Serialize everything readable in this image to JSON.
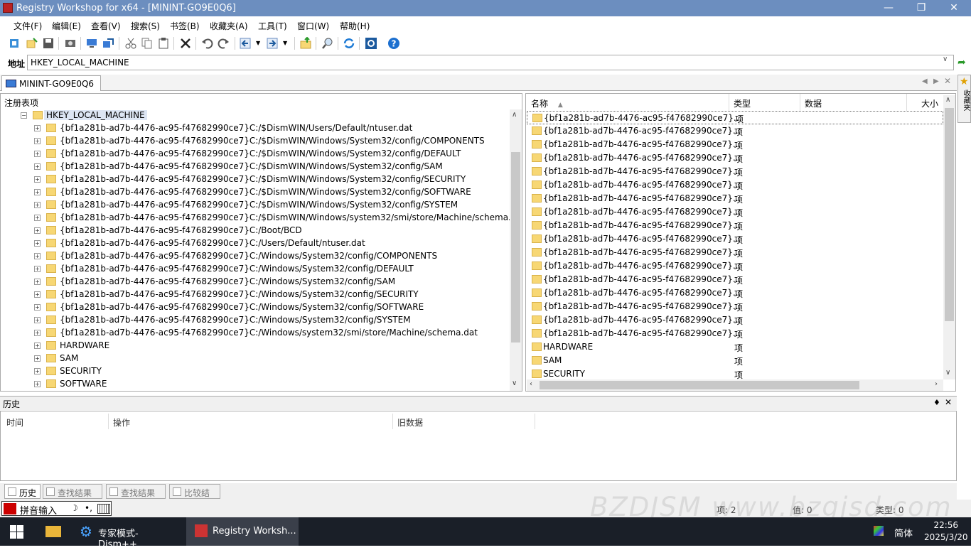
{
  "window": {
    "title": "Registry Workshop for x64 - [MININT-GO9E0Q6]"
  },
  "menu": [
    "文件(F)",
    "编辑(E)",
    "查看(V)",
    "搜索(S)",
    "书签(B)",
    "收藏夹(A)",
    "工具(T)",
    "窗口(W)",
    "帮助(H)"
  ],
  "toolbar": {
    "icons": [
      "connect-icon",
      "new-key-icon",
      "save-icon",
      "snapshot-icon",
      "computer-icon",
      "export-icon",
      "cut-icon",
      "copy-icon",
      "paste-icon",
      "delete-icon",
      "undo-icon",
      "redo-icon",
      "back-icon",
      "forward-icon",
      "parent-key-icon",
      "find-icon",
      "refresh-icon",
      "settings-icon",
      "help-icon"
    ]
  },
  "address": {
    "label": "地址",
    "value": "HKEY_LOCAL_MACHINE"
  },
  "doc_tab": {
    "label": "MININT-GO9E0Q6"
  },
  "sidebar": {
    "label": "收藏夹"
  },
  "tree": {
    "header": "注册表项",
    "root": "HKEY_LOCAL_MACHINE",
    "items": [
      "{bf1a281b-ad7b-4476-ac95-f47682990ce7}C:/$DismWIN/Users/Default/ntuser.dat",
      "{bf1a281b-ad7b-4476-ac95-f47682990ce7}C:/$DismWIN/Windows/System32/config/COMPONENTS",
      "{bf1a281b-ad7b-4476-ac95-f47682990ce7}C:/$DismWIN/Windows/System32/config/DEFAULT",
      "{bf1a281b-ad7b-4476-ac95-f47682990ce7}C:/$DismWIN/Windows/System32/config/SAM",
      "{bf1a281b-ad7b-4476-ac95-f47682990ce7}C:/$DismWIN/Windows/System32/config/SECURITY",
      "{bf1a281b-ad7b-4476-ac95-f47682990ce7}C:/$DismWIN/Windows/System32/config/SOFTWARE",
      "{bf1a281b-ad7b-4476-ac95-f47682990ce7}C:/$DismWIN/Windows/System32/config/SYSTEM",
      "{bf1a281b-ad7b-4476-ac95-f47682990ce7}C:/$DismWIN/Windows/system32/smi/store/Machine/schema.dat",
      "{bf1a281b-ad7b-4476-ac95-f47682990ce7}C:/Boot/BCD",
      "{bf1a281b-ad7b-4476-ac95-f47682990ce7}C:/Users/Default/ntuser.dat",
      "{bf1a281b-ad7b-4476-ac95-f47682990ce7}C:/Windows/System32/config/COMPONENTS",
      "{bf1a281b-ad7b-4476-ac95-f47682990ce7}C:/Windows/System32/config/DEFAULT",
      "{bf1a281b-ad7b-4476-ac95-f47682990ce7}C:/Windows/System32/config/SAM",
      "{bf1a281b-ad7b-4476-ac95-f47682990ce7}C:/Windows/System32/config/SECURITY",
      "{bf1a281b-ad7b-4476-ac95-f47682990ce7}C:/Windows/System32/config/SOFTWARE",
      "{bf1a281b-ad7b-4476-ac95-f47682990ce7}C:/Windows/System32/config/SYSTEM",
      "{bf1a281b-ad7b-4476-ac95-f47682990ce7}C:/Windows/system32/smi/store/Machine/schema.dat",
      "HARDWARE",
      "SAM",
      "SECURITY",
      "SOFTWARE"
    ]
  },
  "list": {
    "columns": [
      "名称",
      "类型",
      "数据",
      "大小"
    ],
    "rows": [
      {
        "name": "{bf1a281b-ad7b-4476-ac95-f47682990ce7}...",
        "type": "项"
      },
      {
        "name": "{bf1a281b-ad7b-4476-ac95-f47682990ce7}...",
        "type": "项"
      },
      {
        "name": "{bf1a281b-ad7b-4476-ac95-f47682990ce7}...",
        "type": "项"
      },
      {
        "name": "{bf1a281b-ad7b-4476-ac95-f47682990ce7}...",
        "type": "项"
      },
      {
        "name": "{bf1a281b-ad7b-4476-ac95-f47682990ce7}...",
        "type": "项"
      },
      {
        "name": "{bf1a281b-ad7b-4476-ac95-f47682990ce7}...",
        "type": "项"
      },
      {
        "name": "{bf1a281b-ad7b-4476-ac95-f47682990ce7}...",
        "type": "项"
      },
      {
        "name": "{bf1a281b-ad7b-4476-ac95-f47682990ce7}...",
        "type": "项"
      },
      {
        "name": "{bf1a281b-ad7b-4476-ac95-f47682990ce7}...",
        "type": "项"
      },
      {
        "name": "{bf1a281b-ad7b-4476-ac95-f47682990ce7}...",
        "type": "项"
      },
      {
        "name": "{bf1a281b-ad7b-4476-ac95-f47682990ce7}...",
        "type": "项"
      },
      {
        "name": "{bf1a281b-ad7b-4476-ac95-f47682990ce7}...",
        "type": "项"
      },
      {
        "name": "{bf1a281b-ad7b-4476-ac95-f47682990ce7}...",
        "type": "项"
      },
      {
        "name": "{bf1a281b-ad7b-4476-ac95-f47682990ce7}...",
        "type": "项"
      },
      {
        "name": "{bf1a281b-ad7b-4476-ac95-f47682990ce7}...",
        "type": "项"
      },
      {
        "name": "{bf1a281b-ad7b-4476-ac95-f47682990ce7}...",
        "type": "项"
      },
      {
        "name": "{bf1a281b-ad7b-4476-ac95-f47682990ce7}...",
        "type": "项"
      },
      {
        "name": "HARDWARE",
        "type": "项"
      },
      {
        "name": "SAM",
        "type": "项"
      },
      {
        "name": "SECURITY",
        "type": "项"
      }
    ]
  },
  "history": {
    "title": "历史",
    "columns": [
      "时间",
      "操作",
      "旧数据"
    ]
  },
  "bottom_tabs": [
    "历史",
    "查找结果 1",
    "查找结果 2",
    "比较结果"
  ],
  "statusbar": {
    "ime": "拼音输入",
    "items": [
      "项: 2",
      "值: 0",
      "类型: 0"
    ]
  },
  "watermark": "BZDJSM www.bzgjsd.com",
  "taskbar": {
    "apps": [
      "专家模式-Dism++...",
      "Registry Worksh..."
    ],
    "lang": "简体",
    "time": "22:56",
    "date": "2025/3/20"
  },
  "colors": {
    "titlebar": "#6c8ebf",
    "selection": "#dde6f4",
    "folder": "#f7d774",
    "taskbar": "#1a1f28"
  }
}
